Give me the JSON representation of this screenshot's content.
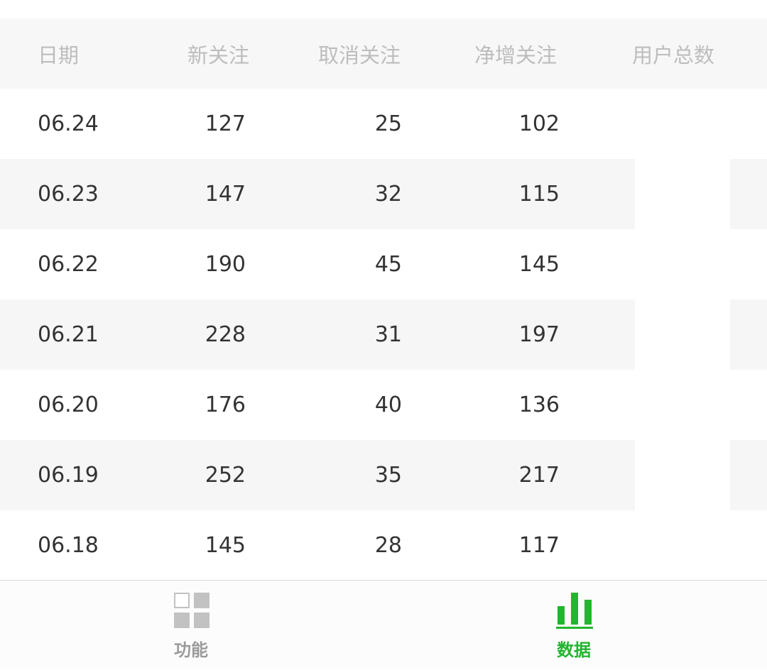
{
  "table": {
    "headers": {
      "date": "日期",
      "new_follows": "新关注",
      "unfollows": "取消关注",
      "net_follows": "净增关注",
      "total_users": "用户总数"
    },
    "rows": [
      {
        "date": "06.24",
        "new_follows": "127",
        "unfollows": "25",
        "net_follows": "102"
      },
      {
        "date": "06.23",
        "new_follows": "147",
        "unfollows": "32",
        "net_follows": "115"
      },
      {
        "date": "06.22",
        "new_follows": "190",
        "unfollows": "45",
        "net_follows": "145"
      },
      {
        "date": "06.21",
        "new_follows": "228",
        "unfollows": "31",
        "net_follows": "197"
      },
      {
        "date": "06.20",
        "new_follows": "176",
        "unfollows": "40",
        "net_follows": "136"
      },
      {
        "date": "06.19",
        "new_follows": "252",
        "unfollows": "35",
        "net_follows": "217"
      },
      {
        "date": "06.18",
        "new_follows": "145",
        "unfollows": "28",
        "net_follows": "117"
      }
    ]
  },
  "tabbar": {
    "tabs": [
      {
        "label": "功能",
        "icon": "grid-icon",
        "active": false
      },
      {
        "label": "数据",
        "icon": "bar-chart-icon",
        "active": true
      }
    ],
    "active_color": "#22b52e",
    "inactive_color": "#9b9b9b"
  }
}
